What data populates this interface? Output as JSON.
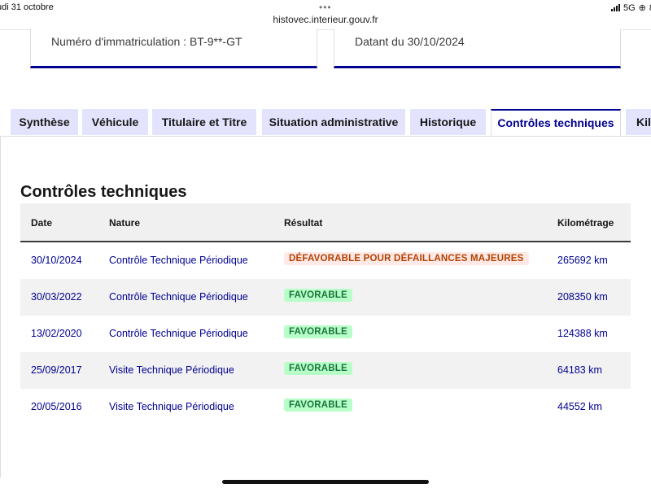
{
  "status_bar": {
    "date": "udi 31 octobre",
    "url": "histovec.interieur.gouv.fr",
    "network": "5G",
    "battery_cut": "8"
  },
  "cards": {
    "registration": "Numéro d'immatriculation : BT-9**-GT",
    "dated": "Datant du 30/10/2024"
  },
  "tabs": [
    {
      "label": "Synthèse",
      "active": false
    },
    {
      "label": "Véhicule",
      "active": false
    },
    {
      "label": "Titulaire et Titre",
      "active": false
    },
    {
      "label": "Situation administrative",
      "active": false
    },
    {
      "label": "Historique",
      "active": false
    },
    {
      "label": "Contrôles techniques",
      "active": true
    },
    {
      "label": "Kil",
      "active": false
    }
  ],
  "section": {
    "title": "Contrôles techniques"
  },
  "table": {
    "headers": [
      "Date",
      "Nature",
      "Résultat",
      "Kilométrage"
    ],
    "rows": [
      {
        "date": "30/10/2024",
        "nature": "Contrôle Technique Périodique",
        "result": "DÉFAVORABLE POUR DÉFAILLANCES MAJEURES",
        "status": "error",
        "km": "265692 km"
      },
      {
        "date": "30/03/2022",
        "nature": "Contrôle Technique Périodique",
        "result": "FAVORABLE",
        "status": "success",
        "km": "208350 km"
      },
      {
        "date": "13/02/2020",
        "nature": "Contrôle Technique Périodique",
        "result": "FAVORABLE",
        "status": "success",
        "km": "124388 km"
      },
      {
        "date": "25/09/2017",
        "nature": "Visite Technique Périodique",
        "result": "FAVORABLE",
        "status": "success",
        "km": "64183 km"
      },
      {
        "date": "20/05/2016",
        "nature": "Visite Technique Périodique",
        "result": "FAVORABLE",
        "status": "success",
        "km": "44552 km"
      }
    ]
  },
  "colors": {
    "primary": "#000091",
    "tab_background": "#e3e3fd",
    "success_text": "#18753c",
    "success_bg": "#b8fec9",
    "error_text": "#b34000",
    "error_bg": "#ffe9e6"
  },
  "icons": [
    "cellular-signal-icon",
    "rotation-lock-icon",
    "more-dots-icon"
  ]
}
